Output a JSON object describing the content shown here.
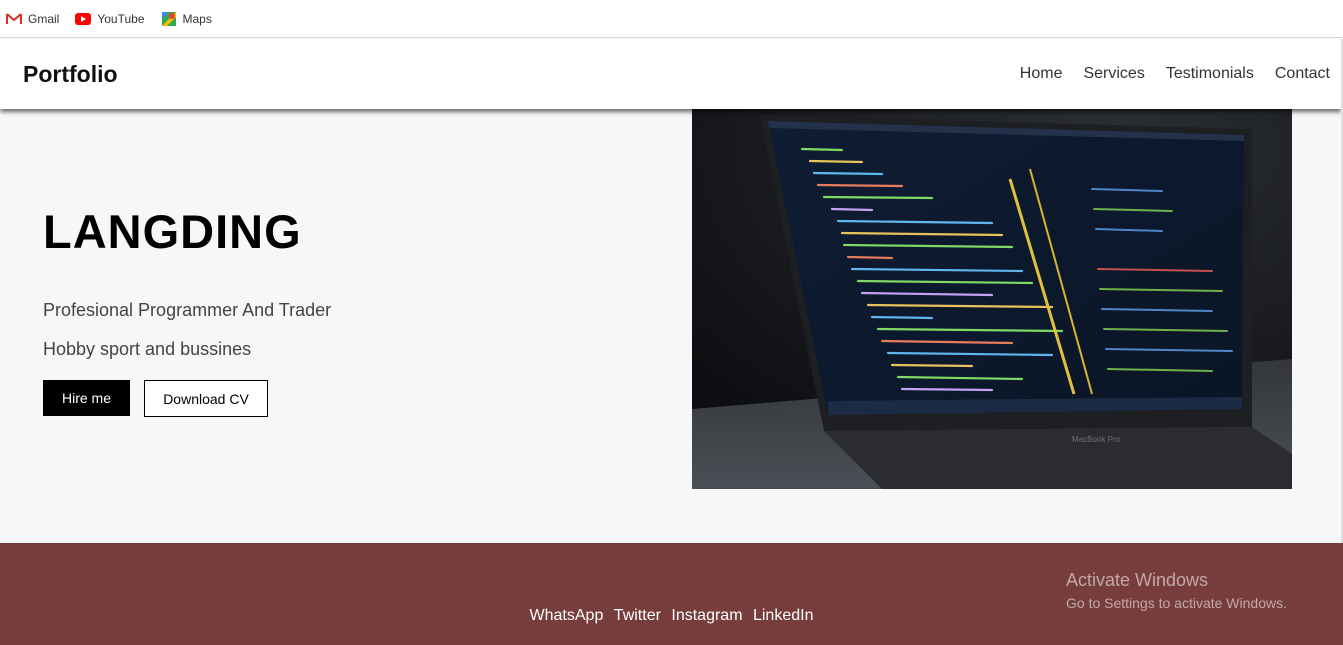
{
  "bookmarks": [
    {
      "label": "Gmail",
      "icon": "gmail-icon"
    },
    {
      "label": "YouTube",
      "icon": "youtube-icon"
    },
    {
      "label": "Maps",
      "icon": "maps-icon"
    }
  ],
  "navbar": {
    "brand": "Portfolio",
    "links": [
      "Home",
      "Services",
      "Testimonials",
      "Contact"
    ]
  },
  "hero": {
    "title": "LANGDING",
    "line1": "Profesional Programmer And Trader",
    "line2": "Hobby sport and bussines",
    "hire_label": "Hire me",
    "cv_label": "Download CV",
    "image_laptop_label": "MacBook Pro"
  },
  "footer": {
    "links": [
      "WhatsApp",
      "Twitter",
      "Instagram",
      "LinkedIn"
    ],
    "background": "#763d3c"
  },
  "watermark": {
    "line1": "Activate Windows",
    "line2": "Go to Settings to activate Windows."
  }
}
